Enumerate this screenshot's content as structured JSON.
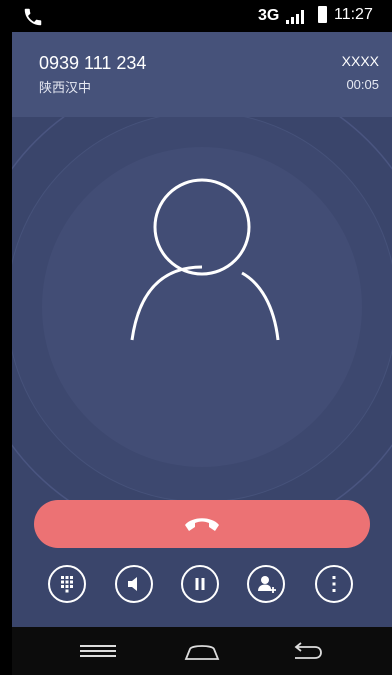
{
  "status_bar": {
    "network": "3G",
    "time": "11:27",
    "icons": [
      "phone-call-icon",
      "signal-icon",
      "battery-icon"
    ]
  },
  "call": {
    "number": "0939 111 234",
    "location": "陕西汉中",
    "sim_label": "XXXX",
    "duration": "00:05"
  },
  "colors": {
    "background": "#3a456b",
    "header": "#46527a",
    "end_call": "#ec7274"
  },
  "controls": [
    {
      "name": "dialpad",
      "icon": "dialpad-icon"
    },
    {
      "name": "speaker",
      "icon": "speaker-icon"
    },
    {
      "name": "hold",
      "icon": "pause-icon"
    },
    {
      "name": "add-call",
      "icon": "add-contact-icon"
    },
    {
      "name": "more",
      "icon": "more-vertical-icon"
    }
  ],
  "nav": [
    "menu-icon",
    "home-icon",
    "back-icon"
  ]
}
